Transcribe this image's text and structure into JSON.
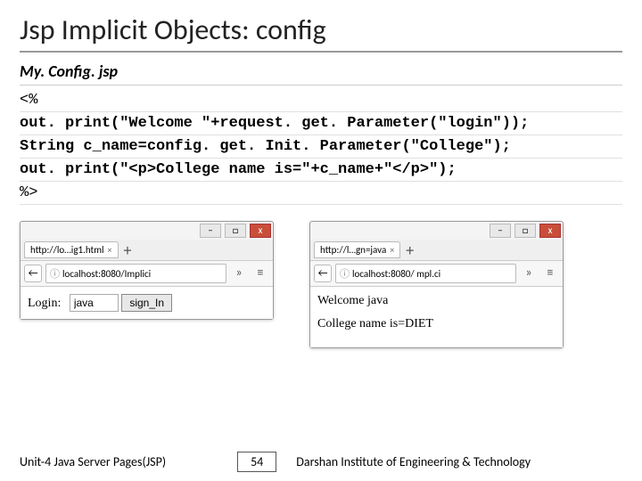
{
  "title": "Jsp Implicit Objects: config",
  "filename": "My. Config. jsp",
  "code": {
    "l1": "<%",
    "l2": "out. print(\"Welcome \"+request. get. Parameter(\"login\"));",
    "l3": "String c_name=config. get. Init. Parameter(\"College\");",
    "l4": "out. print(\"<p>College name is=\"+c_name+\"</p>\");",
    "l5": "%>"
  },
  "browser1": {
    "tab": "http://lo…ig1.html",
    "address": "localhost:8080/Implici",
    "login_label": "Login:",
    "login_value": "java",
    "button": "sign_In"
  },
  "browser2": {
    "tab": "http://l…gn=java",
    "address": "localhost:8080/ mpl.ci",
    "line1": "Welcome java",
    "line2": "College name is=DIET"
  },
  "win": {
    "min": "–",
    "max": "□",
    "close": "x"
  },
  "nav": {
    "back": "←",
    "info": "ⓘ",
    "chev": "»",
    "menu": "≡",
    "plus": "+",
    "x": "×"
  },
  "footer": {
    "left": "Unit-4 Java Server Pages(JSP)",
    "page": "54",
    "right": "Darshan Institute of Engineering & Technology"
  }
}
